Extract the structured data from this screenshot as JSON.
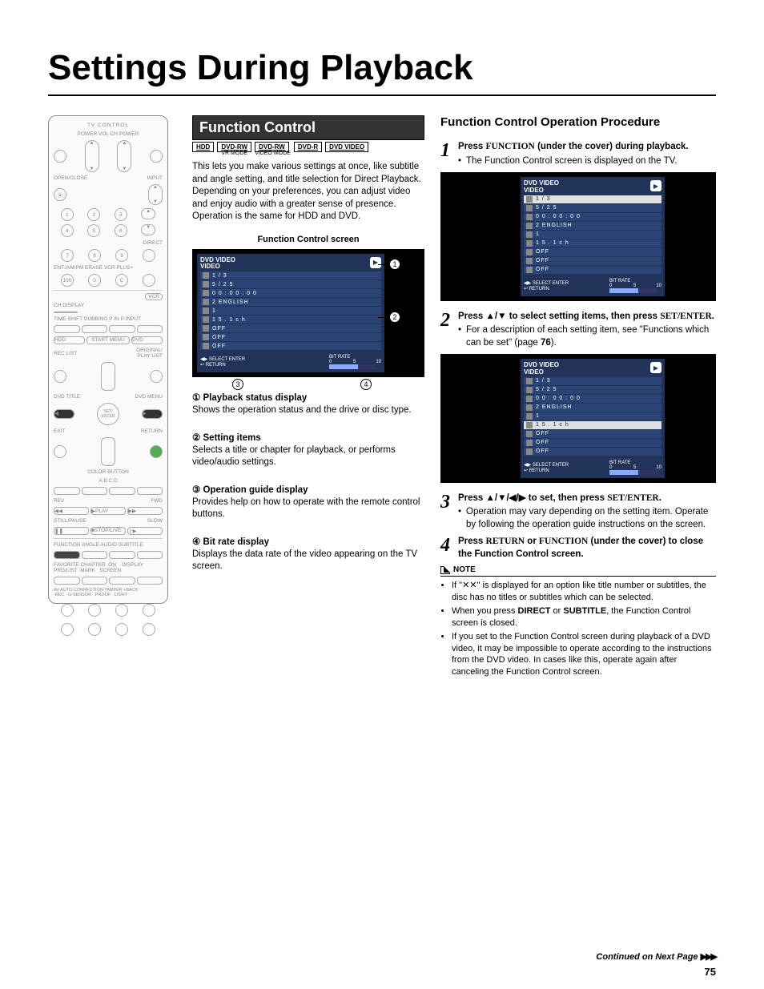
{
  "page": {
    "title": "Settings During Playback",
    "number": "75",
    "continued": "Continued on Next Page"
  },
  "remote": {
    "tv_control": "TV CONTROL",
    "labels": {
      "r1": "POWER   VOL   CH   POWER",
      "r2l": "OPEN/CLOSE",
      "r2r": "INPUT",
      "ch": "CH",
      "direct": "DIRECT",
      "r5": "ENT./AM/PM          ERASE  VCR PLUS+",
      "vcr": "VCR",
      "r7": "CH DISPLAY",
      "r8": "TIME SHIFT  DUBBING  P IN P   INPUT",
      "hdd": "HDD",
      "start": "START MENU",
      "dvd": "DVD",
      "reclist": "REC LIST",
      "origpl": "ORIGINAL/\nPLAY LIST",
      "dvdtitle": "DVD TITLE",
      "dvdmenu": "DVD MENU",
      "setenter": "SET/\nENTER",
      "exit": "EXIT",
      "return": "RETURN",
      "color": "COLOR BUTTON",
      "abcd": "A      B      C      D",
      "rev": "REV",
      "fwd": "FWD",
      "play": "▶PLAY",
      "still": "STILL/PAUSE",
      "slow": "SLOW",
      "stoplive": "■STOP/LIVE",
      "func_row": "FUNCTION  ANGLE   AUDIO  SUBTITLE",
      "fav_row": "FAVORITE CHAPTER  ON    DISPLAY\nPRG/LIST  MARK   SCREEN",
      "bottom": "AV AUTO CORRECTION TAMPER +BACK\n REC   G-SENSOR   PROOF   LIGHT"
    }
  },
  "function_control": {
    "heading": "Function Control",
    "tags": [
      "HDD",
      "DVD-RW",
      "DVD-RW",
      "DVD-R",
      "DVD VIDEO"
    ],
    "tag_subs": [
      "",
      "VR MODE",
      "VIDEO MODE",
      "",
      ""
    ],
    "intro": "This lets you make various settings at once, like subtitle and angle setting, and title selection for Direct Playback.\nDepending on your preferences, you can adjust video and enjoy audio with a greater sense of presence. Operation is the same for HDD and DVD.",
    "screen_label": "Function Control screen",
    "items": [
      {
        "n": "①",
        "title": "Playback status display",
        "body": "Shows the operation status and the drive or disc type."
      },
      {
        "n": "②",
        "title": "Setting items",
        "body": "Selects a title or chapter for playback, or performs video/audio settings."
      },
      {
        "n": "③",
        "title": "Operation guide display",
        "body": "Provides help on how to operate with the remote control buttons."
      },
      {
        "n": "④",
        "title": "Bit rate display",
        "body": "Displays the data rate of the video appearing on the TV screen."
      }
    ]
  },
  "osd": {
    "title1": "DVD VIDEO",
    "title2": "VIDEO",
    "rows": [
      "1 / 3",
      "5 / 2 5",
      "0 0 : 0 0 : 0 0",
      "2 ENGLISH",
      "1",
      "1    5 . 1 c h",
      "OFF",
      "OFF",
      "OFF"
    ],
    "footer_left1": "SELECT         ENTER",
    "footer_left2": "RETURN",
    "footer_right": "BIT RATE\n0                5               10"
  },
  "procedure": {
    "heading": "Function Control Operation Procedure",
    "steps": [
      {
        "n": "1",
        "title_pre": "Press ",
        "title_strong": "FUNCTION",
        "title_post": " (under the cover) during playback.",
        "bullets": [
          "The Function Control screen is displayed on the TV."
        ]
      },
      {
        "n": "2",
        "title_pre": "Press ",
        "arrows": "▲/▼",
        "title_mid": " to select setting items, then press ",
        "title_strong": "SET/ENTER",
        "title_post": ".",
        "bullets": [
          "For a description of each setting item, see \"Functions which can be set\" (page 76)."
        ]
      },
      {
        "n": "3",
        "title_pre": "Press ",
        "arrows": "▲/▼/◀/▶",
        "title_mid": " to set, then press ",
        "title_strong": "SET/ENTER",
        "title_post": ".",
        "bullets": [
          "Operation may vary depending on the setting item. Operate by following the operation guide instructions on the screen."
        ]
      },
      {
        "n": "4",
        "title_pre": "Press ",
        "title_strong": "RETURN",
        "title_mid2": " or ",
        "title_strong2": "FUNCTION",
        "title_post": " (under the cover) to close the Function Control screen.",
        "bullets": []
      }
    ],
    "page_ref": "76"
  },
  "note": {
    "label": "NOTE",
    "items": [
      "If \"✕✕\" is displayed for an option like title number or subtitles, the disc has no titles or subtitles which can be selected.",
      "When you press DIRECT or SUBTITLE, the Function Control screen is closed.",
      "If you set to the Function Control screen during playback of a DVD video, it may be impossible to operate according to the instructions from the DVD video. In cases like this, operate again after canceling the Function Control screen."
    ],
    "bold1": "DIRECT",
    "bold2": "SUBTITLE"
  }
}
